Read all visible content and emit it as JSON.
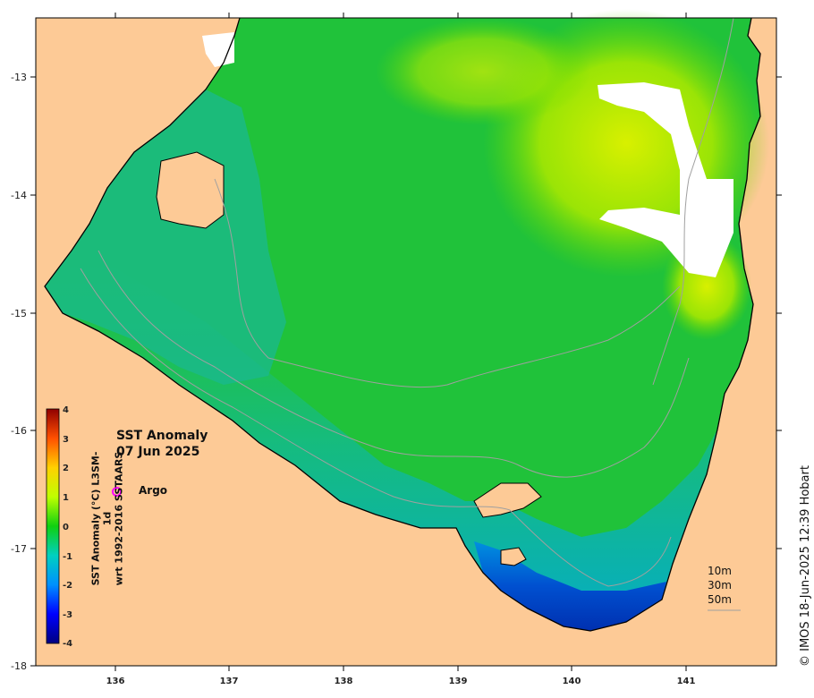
{
  "map": {
    "title_line1": "SST Anomaly",
    "title_line2": "07 Jun 2025",
    "argo_label": "Argo",
    "colorbar_label_line1": "SST Anomaly (°C) L3SM-1d",
    "colorbar_label_line2": "wrt 1992-2016 SSTAARS",
    "colorbar_ticks": [
      "4",
      "3",
      "2",
      "1",
      "0",
      "-1",
      "-2",
      "-3",
      "-4"
    ],
    "lat_ticks": [
      "-13",
      "-14",
      "-15",
      "-16",
      "-17",
      "-18"
    ],
    "lon_ticks": [
      "136",
      "137",
      "138",
      "139",
      "140",
      "141"
    ],
    "depth_legend": [
      "10m",
      "30m",
      "50m"
    ],
    "credit": "© IMOS 18-Jun-2025 12:39 Hobart",
    "colors": {
      "land": "#fdca96",
      "ocean_base": "#1fc23a",
      "ocean_cool": "#10b890",
      "ocean_cold": "#0a40d0",
      "ocean_warm": "#c8f000",
      "no_data": "#ffffff",
      "argo": "#ff00ff"
    }
  }
}
